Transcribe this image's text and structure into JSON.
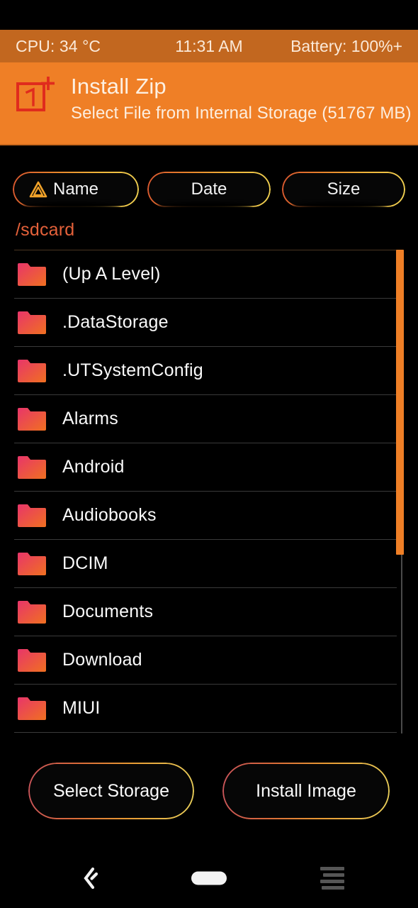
{
  "status_bar": {
    "cpu": "CPU: 34 °C",
    "time": "11:31 AM",
    "battery": "Battery: 100%+"
  },
  "header": {
    "logo_icon": "oneplus-logo-icon",
    "title": "Install Zip",
    "subtitle": "Select File from Internal Storage (51767 MB)",
    "background_color": "#ef7f26"
  },
  "sort_tabs": [
    {
      "label": "Name",
      "icon": "sort-ascending-triangle-icon",
      "active": true
    },
    {
      "label": "Date",
      "icon": "",
      "active": false
    },
    {
      "label": "Size",
      "icon": "",
      "active": false
    }
  ],
  "path": "/sdcard",
  "file_list": [
    {
      "name": "(Up A Level)",
      "icon": "folder-icon"
    },
    {
      "name": ".DataStorage",
      "icon": "folder-icon"
    },
    {
      "name": ".UTSystemConfig",
      "icon": "folder-icon"
    },
    {
      "name": "Alarms",
      "icon": "folder-icon"
    },
    {
      "name": "Android",
      "icon": "folder-icon"
    },
    {
      "name": "Audiobooks",
      "icon": "folder-icon"
    },
    {
      "name": "DCIM",
      "icon": "folder-icon"
    },
    {
      "name": "Documents",
      "icon": "folder-icon"
    },
    {
      "name": "Download",
      "icon": "folder-icon"
    },
    {
      "name": "MIUI",
      "icon": "folder-icon"
    }
  ],
  "scrollbar": {
    "thumb_color": "#ef7f26",
    "track_color": "#4a4a4a"
  },
  "actions": {
    "select_storage": "Select Storage",
    "install_image": "Install Image"
  },
  "nav_bar": {
    "back_icon": "back-chevron-icon",
    "home_icon": "home-pill-icon",
    "recents_icon": "menu-lines-icon"
  },
  "colors": {
    "accent_orange": "#ef7f26",
    "status_orange": "#c2671f",
    "path_text": "#e4613a",
    "folder_pink": "#e8356a",
    "folder_orange": "#f07020",
    "background": "#000000"
  }
}
